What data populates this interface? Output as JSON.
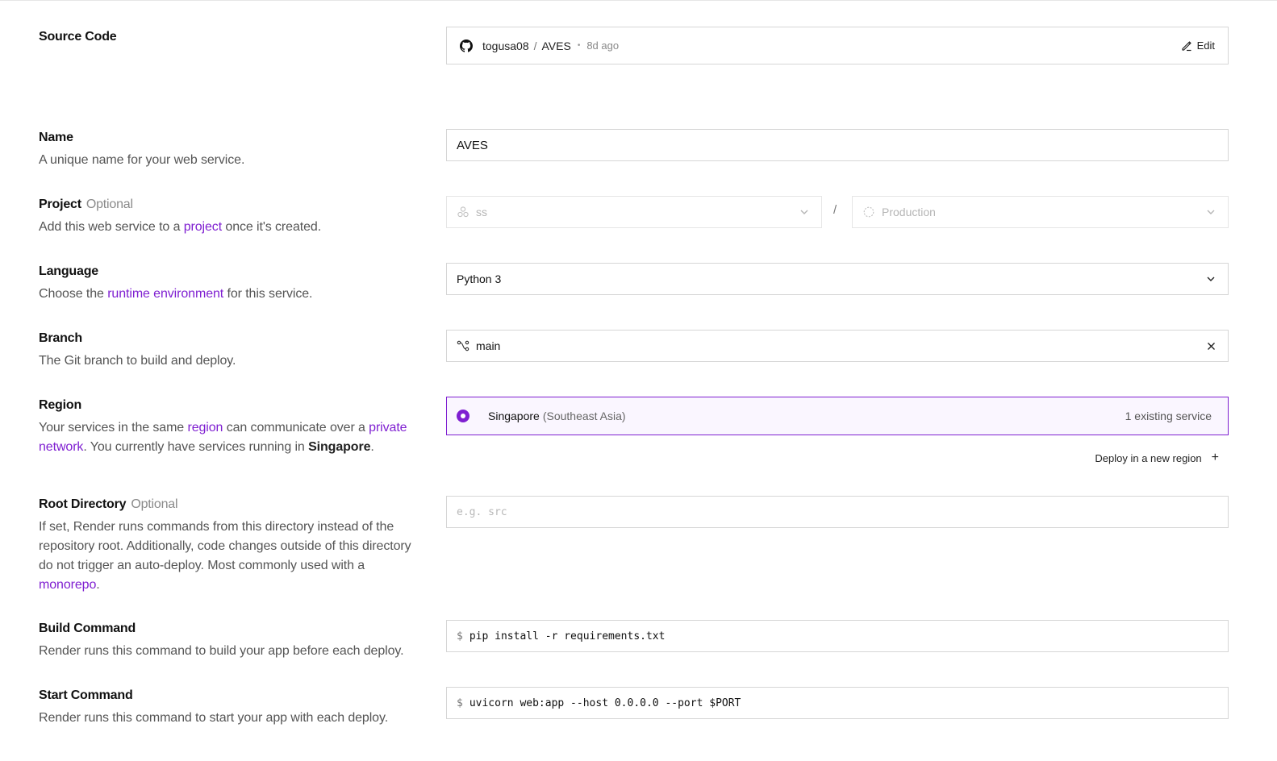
{
  "source": {
    "title": "Source Code",
    "owner": "togusa08",
    "separator": "/",
    "repo": "AVES",
    "dot": "•",
    "time": "8d ago",
    "edit_label": "Edit"
  },
  "name": {
    "title": "Name",
    "desc": "A unique name for your web service.",
    "value": "AVES"
  },
  "project": {
    "title": "Project",
    "optional": "Optional",
    "desc_pre": "Add this web service to a ",
    "desc_link": "project",
    "desc_post": " once it's created.",
    "project_value": "ss",
    "slash": "/",
    "env_value": "Production"
  },
  "language": {
    "title": "Language",
    "desc_pre": "Choose the ",
    "desc_link": "runtime environment",
    "desc_post": " for this service.",
    "value": "Python 3"
  },
  "branch": {
    "title": "Branch",
    "desc": "The Git branch to build and deploy.",
    "value": "main"
  },
  "region": {
    "title": "Region",
    "desc_1": "Your services in the same ",
    "desc_link1": "region",
    "desc_2": " can communicate over a ",
    "desc_link2": "private network",
    "desc_3": ". You currently have services running in ",
    "desc_strong": "Singapore",
    "desc_4": ".",
    "option_name": "Singapore",
    "option_sub": "(Southeast Asia)",
    "option_count": "1 existing service",
    "deploy_new_label": "Deploy in a new region",
    "plus": "+",
    "accent": "#7f1fd1"
  },
  "root": {
    "title": "Root Directory",
    "optional": "Optional",
    "desc_pre": "If set, Render runs commands from this directory instead of the repository root. Additionally, code changes outside of this directory do not trigger an auto-deploy. Most commonly used with a ",
    "desc_link": "monorepo",
    "desc_post": ".",
    "placeholder": "e.g. src"
  },
  "build": {
    "title": "Build Command",
    "desc": "Render runs this command to build your app before each deploy.",
    "prompt": "$",
    "value": "pip install -r requirements.txt"
  },
  "start": {
    "title": "Start Command",
    "desc": "Render runs this command to start your app with each deploy.",
    "prompt": "$",
    "value": "uvicorn web:app --host 0.0.0.0 --port $PORT"
  }
}
